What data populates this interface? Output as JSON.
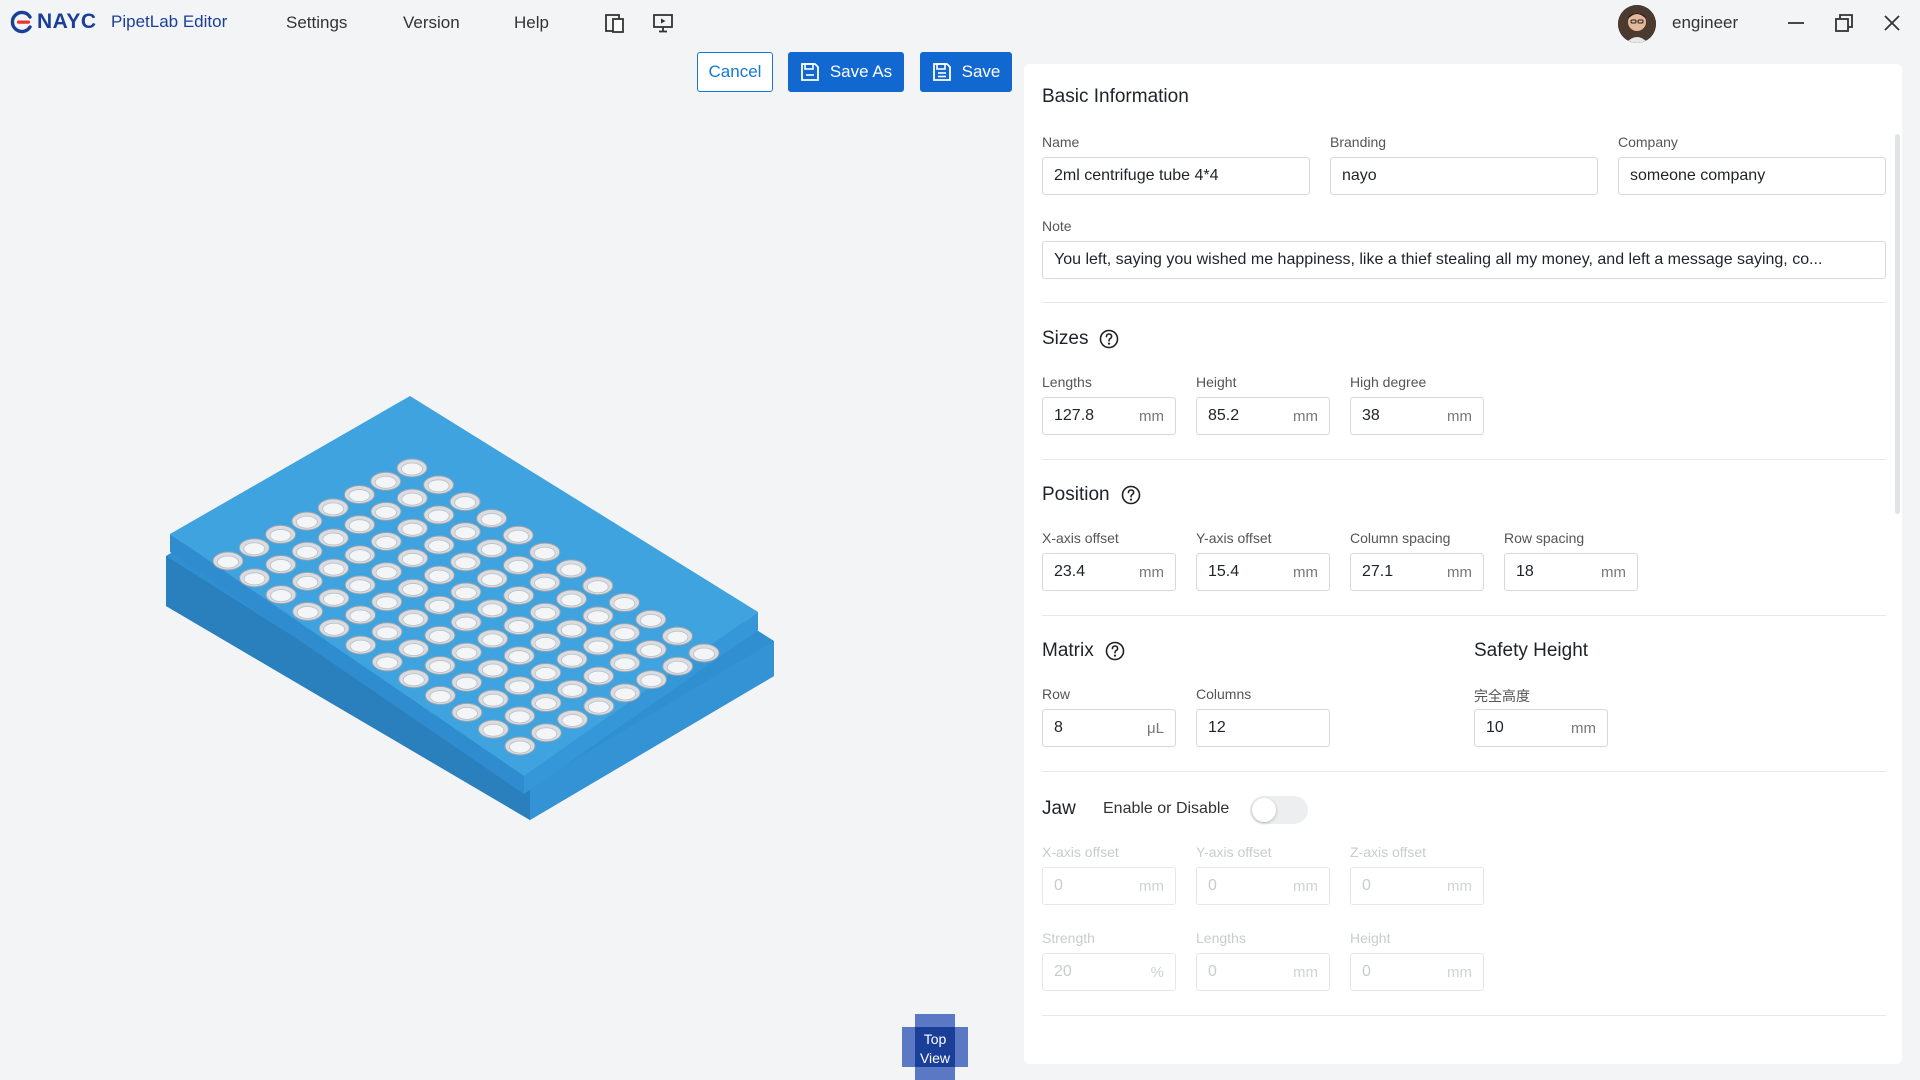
{
  "app": {
    "logo_text": "NAYC",
    "title": "PipetLab Editor"
  },
  "menu": {
    "settings": "Settings",
    "version": "Version",
    "help": "Help"
  },
  "user": {
    "name": "engineer"
  },
  "toolbar": {
    "cancel": "Cancel",
    "save_as": "Save As",
    "save": "Save"
  },
  "viewer": {
    "top_view_line1": "Top",
    "top_view_line2": "View"
  },
  "basic": {
    "title": "Basic Information",
    "name_label": "Name",
    "name_value": "2ml centrifuge tube 4*4",
    "branding_label": "Branding",
    "branding_value": "nayo",
    "company_label": "Company",
    "company_value": "someone company",
    "note_label": "Note",
    "note_value": "You left, saying you wished me happiness, like a thief stealing all my money, and left a message saying, co..."
  },
  "sizes": {
    "title": "Sizes",
    "lengths_label": "Lengths",
    "lengths_value": "127.8",
    "height_label": "Height",
    "height_value": "85.2",
    "high_label": "High degree",
    "high_value": "38",
    "unit": "mm"
  },
  "position": {
    "title": "Position",
    "x_label": "X-axis offset",
    "x_value": "23.4",
    "y_label": "Y-axis offset",
    "y_value": "15.4",
    "col_label": "Column spacing",
    "col_value": "27.1",
    "row_label": "Row spacing",
    "row_value": "18",
    "unit": "mm"
  },
  "matrix": {
    "title": "Matrix",
    "row_label": "Row",
    "row_value": "8",
    "row_unit": "μL",
    "col_label": "Columns",
    "col_value": "12"
  },
  "safety": {
    "title": "Safety Height",
    "label": "完全高度",
    "value": "10",
    "unit": "mm"
  },
  "jaw": {
    "title": "Jaw",
    "toggle_label": "Enable or Disable",
    "enabled": false,
    "x_label": "X-axis offset",
    "x_value": "0",
    "y_label": "Y-axis offset",
    "y_value": "0",
    "z_label": "Z-axis offset",
    "z_value": "0",
    "strength_label": "Strength",
    "strength_value": "20",
    "strength_unit": "%",
    "lengths_label": "Lengths",
    "lengths_value": "0",
    "height_label": "Height",
    "height_value": "0",
    "unit": "mm"
  },
  "colors": {
    "accent": "#1168d0",
    "plate": "#3fa3e0",
    "brand": "#1a3f99",
    "brand_red": "#e8352d"
  }
}
